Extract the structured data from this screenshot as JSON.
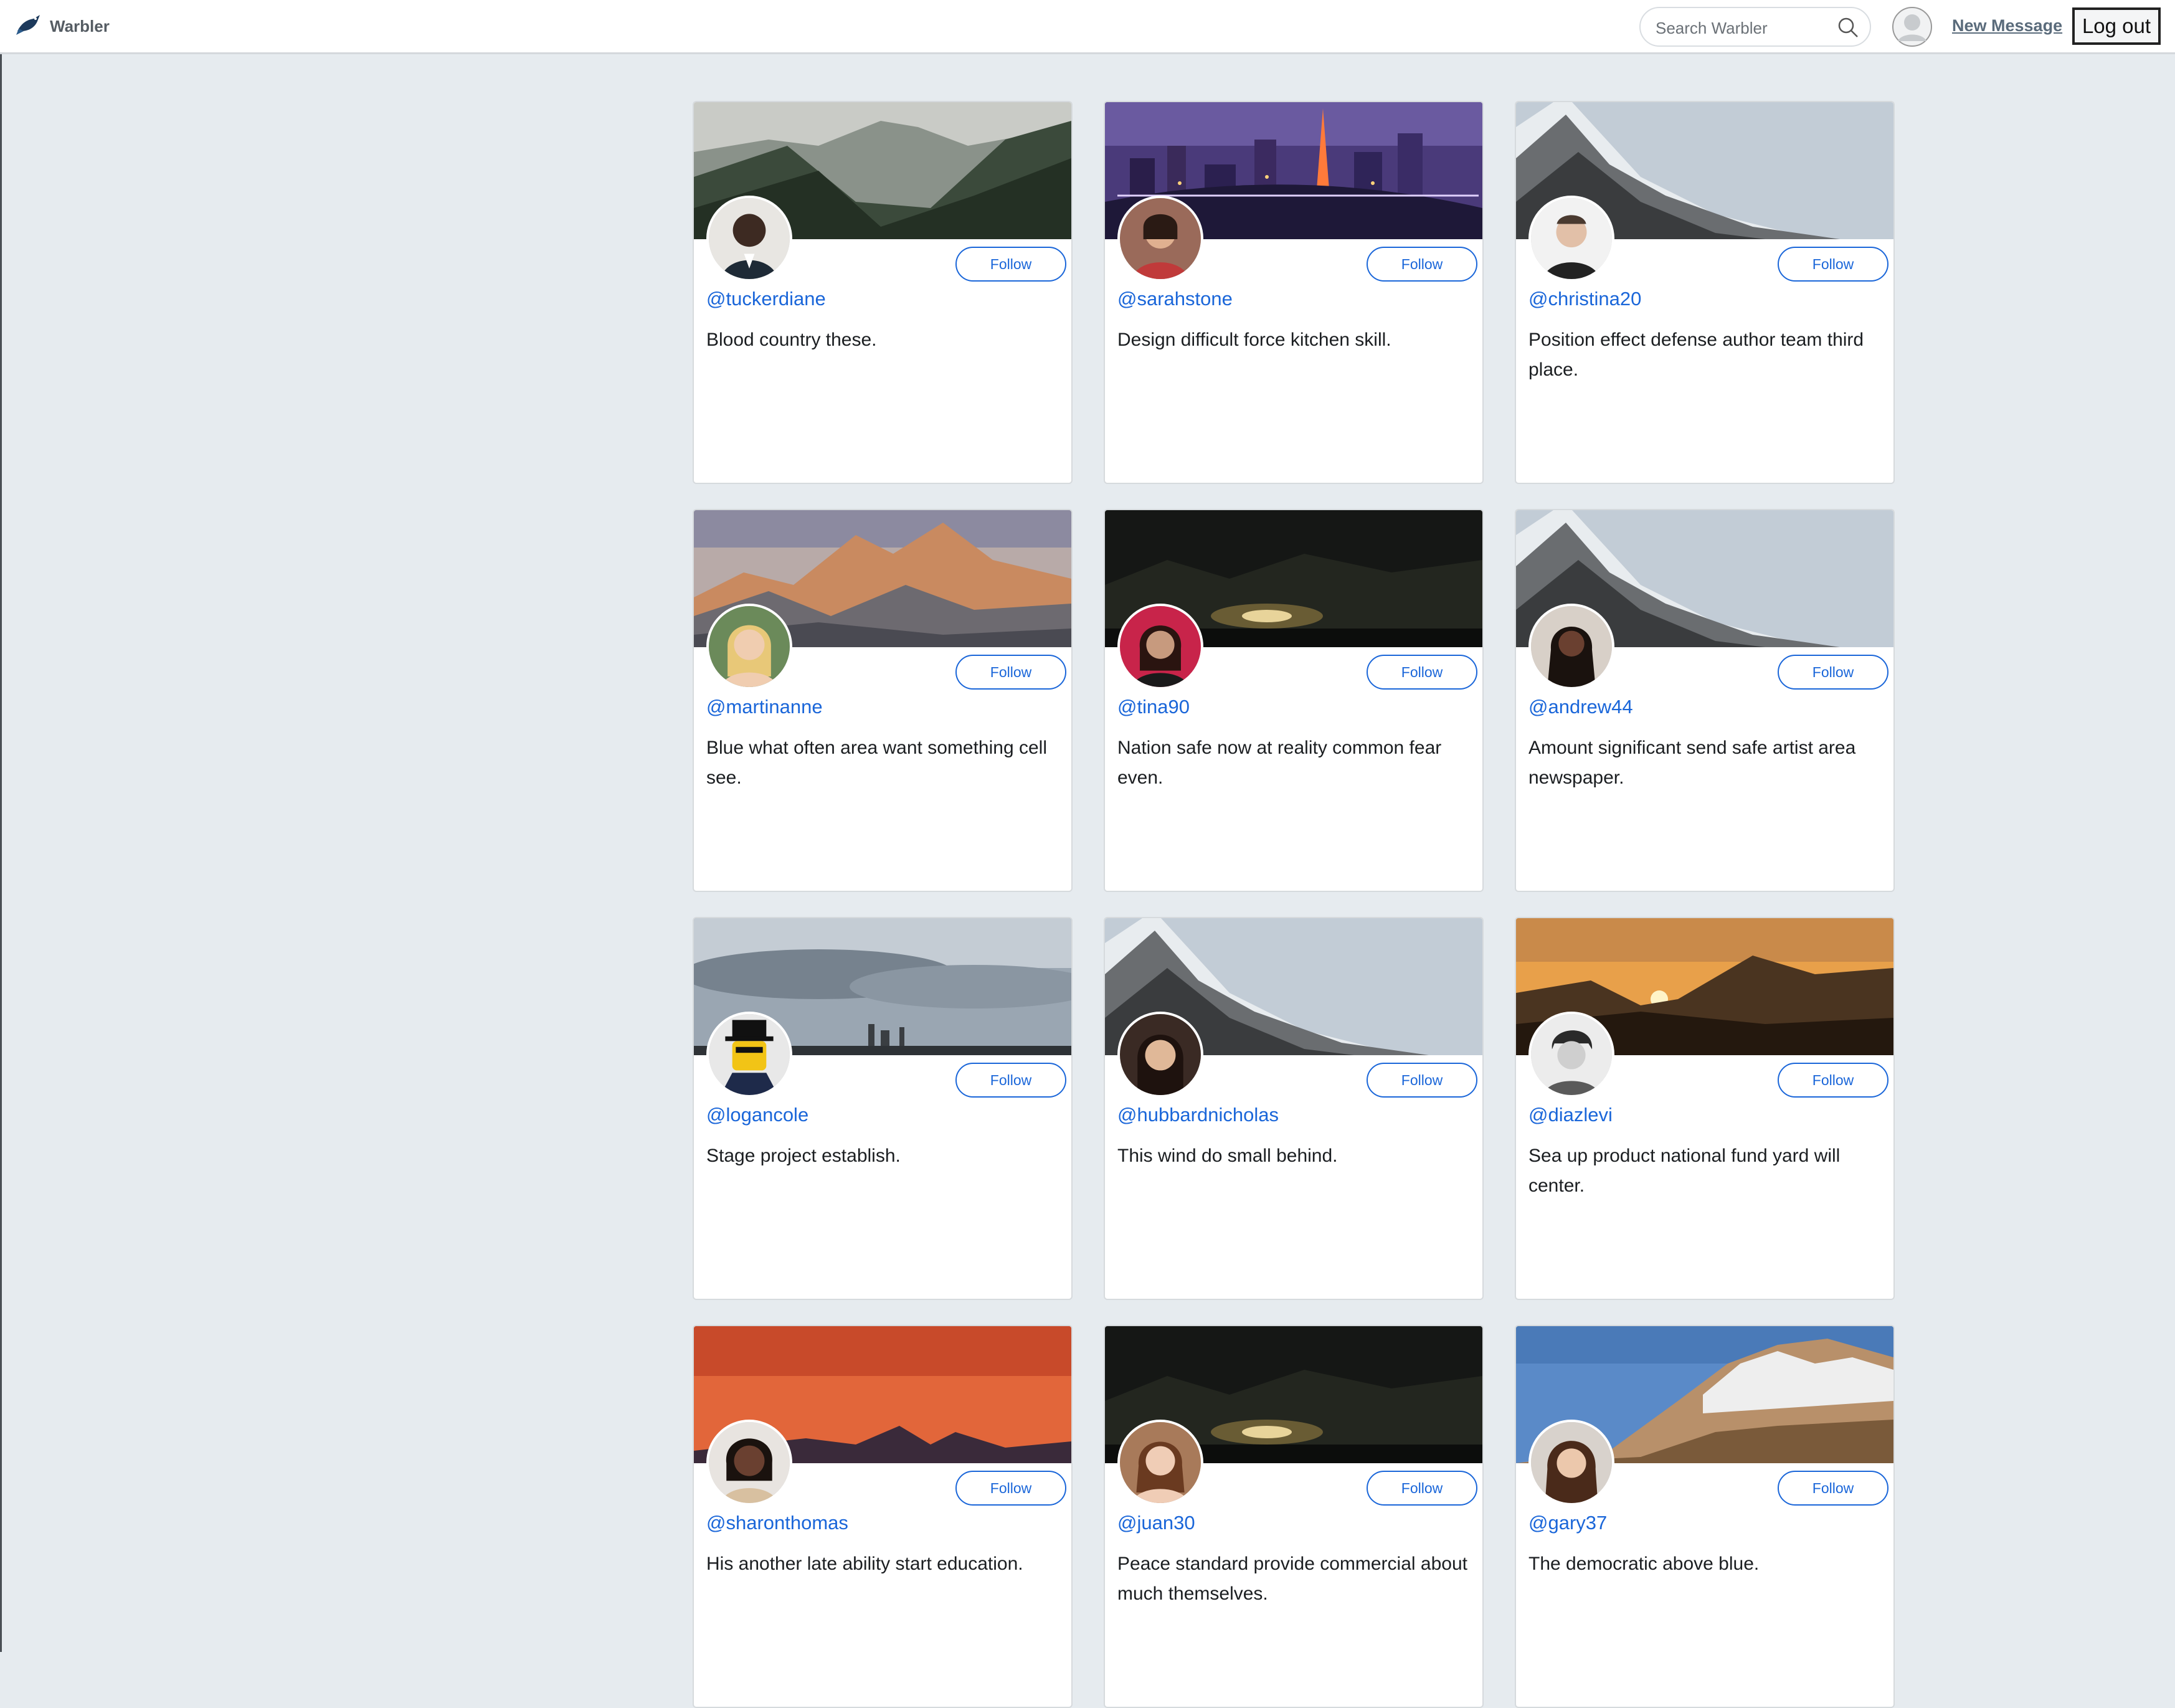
{
  "navbar": {
    "brand": "Warbler",
    "search_placeholder": "Search Warbler",
    "new_message": "New Message",
    "logout": "Log out"
  },
  "colors": {
    "accent": "#1a66d9",
    "page_bg": "#e6ebef"
  },
  "users": [
    {
      "handle": "@tuckerdiane",
      "bio": "Blood country these.",
      "follow": "Follow",
      "hero": "forest"
    },
    {
      "handle": "@sarahstone",
      "bio": "Design difficult force kitchen skill.",
      "follow": "Follow",
      "hero": "city-night"
    },
    {
      "handle": "@christina20",
      "bio": "Position effect defense author team third place.",
      "follow": "Follow",
      "hero": "snow-peak"
    },
    {
      "handle": "@martinanne",
      "bio": "Blue what often area want something cell see.",
      "follow": "Follow",
      "hero": "alpine-dusk"
    },
    {
      "handle": "@tina90",
      "bio": "Nation safe now at reality common fear even.",
      "follow": "Follow",
      "hero": "dark-woods"
    },
    {
      "handle": "@andrew44",
      "bio": "Amount significant send safe artist area newspaper.",
      "follow": "Follow",
      "hero": "snow-peak"
    },
    {
      "handle": "@logancole",
      "bio": "Stage project establish.",
      "follow": "Follow",
      "hero": "cloudy-skyline"
    },
    {
      "handle": "@hubbardnicholas",
      "bio": "This wind do small behind.",
      "follow": "Follow",
      "hero": "snow-peak"
    },
    {
      "handle": "@diazlevi",
      "bio": "Sea up product national fund yard will center.",
      "follow": "Follow",
      "hero": "sunset-mountains"
    },
    {
      "handle": "@sharonthomas",
      "bio": "His another late ability start education.",
      "follow": "Follow",
      "hero": "orange-sky"
    },
    {
      "handle": "@juan30",
      "bio": "Peace standard provide commercial about much themselves.",
      "follow": "Follow",
      "hero": "dark-woods"
    },
    {
      "handle": "@gary37",
      "bio": "The democratic above blue.",
      "follow": "Follow",
      "hero": "rocky-ridge"
    }
  ]
}
